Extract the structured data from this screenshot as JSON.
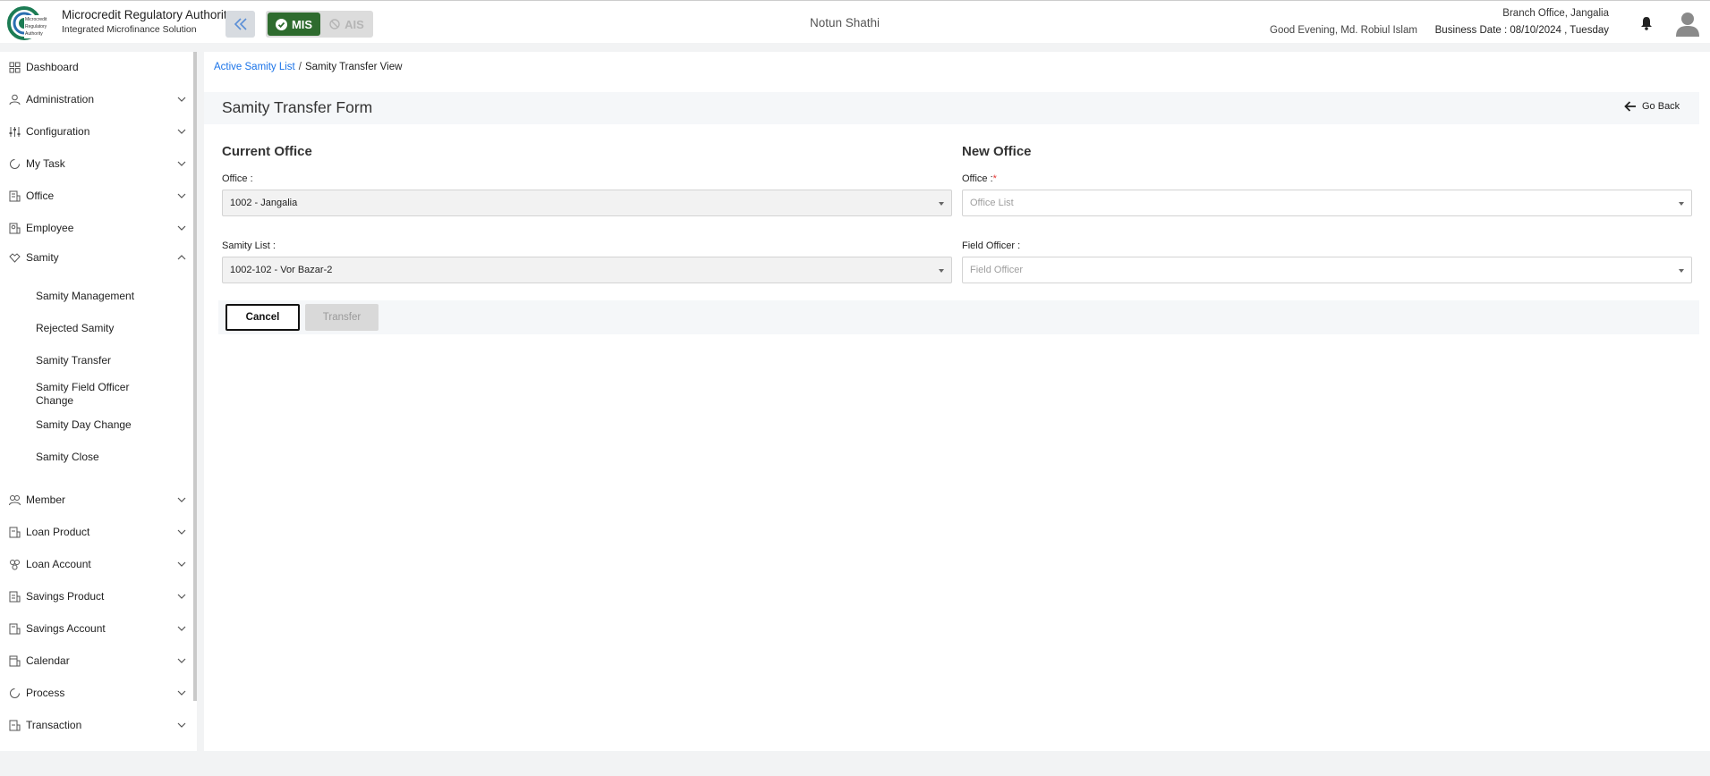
{
  "header": {
    "org_name": "Microcredit Regulatory Authority",
    "org_subtitle": "Integrated Microfinance Solution",
    "logo_text": "Microcredit Regulatory Authority",
    "mode_mis": "MIS",
    "mode_ais": "AIS",
    "center_title": "Notun Shathi",
    "greeting": "Good Evening, Md. Robiul Islam",
    "branch": "Branch Office, Jangalia",
    "business_date": "Business Date : 08/10/2024 , Tuesday"
  },
  "sidebar": {
    "items": [
      {
        "label": "Dashboard",
        "icon": "dashboard-icon"
      },
      {
        "label": "Administration",
        "icon": "admin-icon"
      },
      {
        "label": "Configuration",
        "icon": "sliders-icon"
      },
      {
        "label": "My Task",
        "icon": "task-icon"
      },
      {
        "label": "Office",
        "icon": "office-icon"
      },
      {
        "label": "Employee",
        "icon": "employee-icon"
      },
      {
        "label": "Samity",
        "icon": "samity-icon"
      },
      {
        "label": "Member",
        "icon": "member-icon"
      },
      {
        "label": "Loan Product",
        "icon": "loan-product-icon"
      },
      {
        "label": "Loan Account",
        "icon": "loan-account-icon"
      },
      {
        "label": "Savings Product",
        "icon": "savings-product-icon"
      },
      {
        "label": "Savings Account",
        "icon": "savings-account-icon"
      },
      {
        "label": "Calendar",
        "icon": "calendar-icon"
      },
      {
        "label": "Process",
        "icon": "process-icon"
      },
      {
        "label": "Transaction",
        "icon": "transaction-icon"
      }
    ],
    "samity_sub": [
      "Samity Management",
      "Rejected Samity",
      "Samity Transfer",
      "Samity Field Officer Change",
      "Samity Day Change",
      "Samity Close"
    ]
  },
  "breadcrumb": {
    "link": "Active Samity List",
    "separator": "/",
    "current": "Samity Transfer View"
  },
  "form": {
    "title": "Samity Transfer Form",
    "go_back": "Go Back",
    "current_office": {
      "heading": "Current Office",
      "office_label": "Office :",
      "office_value": "1002 - Jangalia",
      "samity_label": "Samity List :",
      "samity_value": "1002-102 - Vor Bazar-2"
    },
    "new_office": {
      "heading": "New Office",
      "office_label": "Office :",
      "office_required": "*",
      "office_placeholder": "Office List",
      "officer_label": "Field Officer :",
      "officer_placeholder": "Field Officer"
    },
    "cancel_label": "Cancel",
    "transfer_label": "Transfer"
  },
  "colors": {
    "accent_green": "#2e6b2e",
    "link_blue": "#1a73e8",
    "required_red": "#e53935"
  }
}
